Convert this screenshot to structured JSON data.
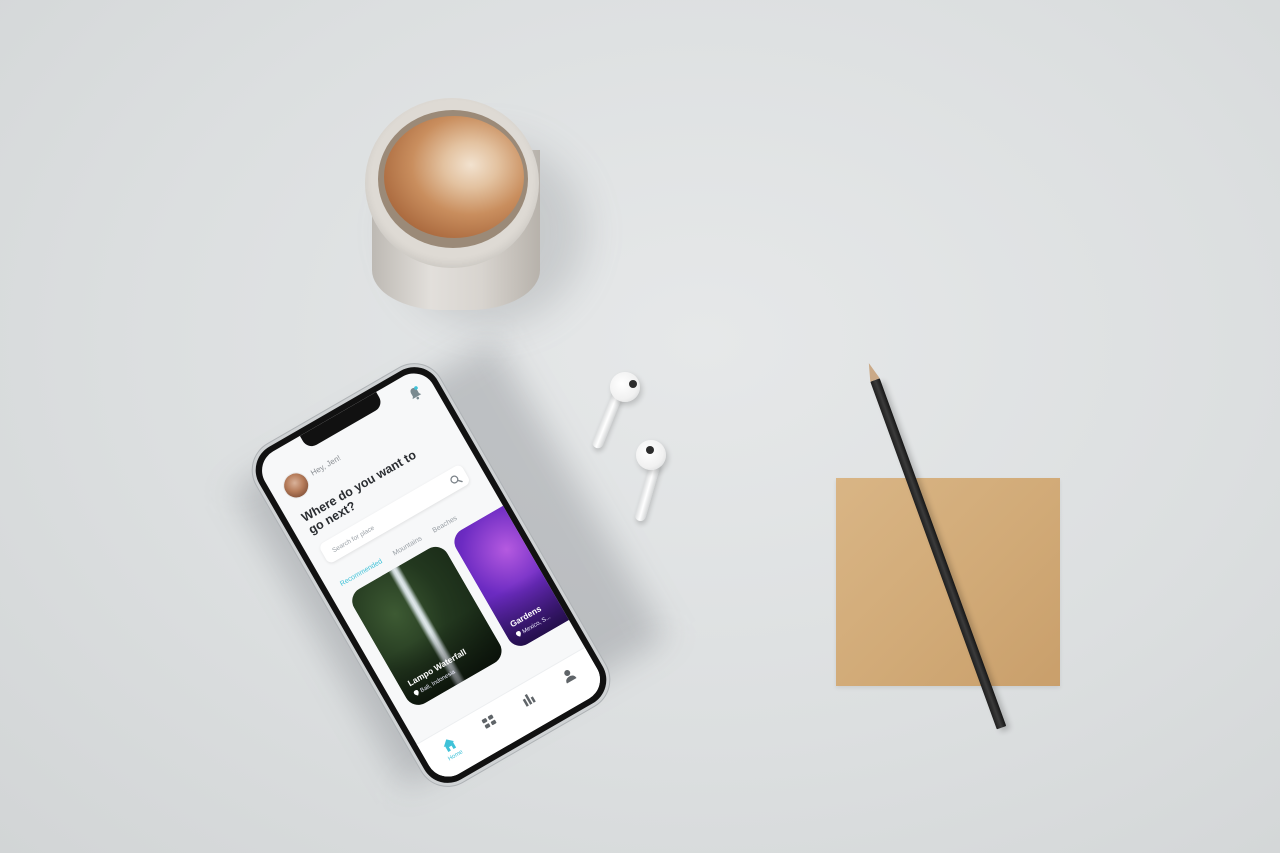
{
  "app": {
    "greeting": "Hey, Jen!",
    "headline": "Where do you want to go next?",
    "search": {
      "placeholder": "Search for place"
    },
    "tabs": [
      "Recommended",
      "Mountains",
      "Beaches"
    ],
    "active_tab": "Recommended",
    "cards": [
      {
        "title": "Lampo Waterfall",
        "location": "Bali, Indonesia"
      },
      {
        "title": "Gardens",
        "location": "Mexico, S..."
      }
    ],
    "bottom_nav": {
      "home_label": "Home"
    },
    "icons": {
      "notification": "bell-icon",
      "search": "search-icon",
      "location": "pin-icon",
      "home": "home-icon",
      "gallery": "gallery-icon",
      "stats": "chart-icon",
      "profile": "profile-icon"
    },
    "colors": {
      "accent": "#3fc2d8",
      "text_dark": "#2a2d31",
      "text_muted": "#9aa0a6"
    }
  }
}
